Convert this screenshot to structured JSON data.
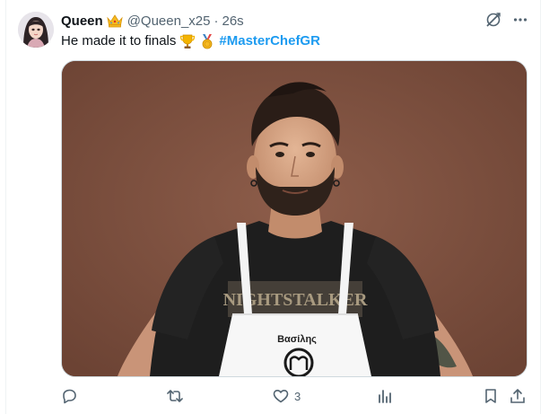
{
  "post": {
    "author": {
      "display_name": "Queen",
      "badge_icon": "crown-emoji",
      "handle": "@Queen_x25",
      "separator": "·",
      "time": "26s"
    },
    "text": {
      "body": "He made it to finals",
      "emojis": [
        "trophy-emoji",
        "medal-emoji"
      ],
      "hashtag": "#MasterChefGR"
    },
    "media": {
      "apron_name": "Βασίλης",
      "shirt_print": "NIGHTSTALKER"
    },
    "actions": {
      "reply": {
        "icon": "reply-icon"
      },
      "repost": {
        "icon": "repost-icon"
      },
      "like": {
        "icon": "heart-icon",
        "count": "3"
      },
      "views": {
        "icon": "views-icon"
      },
      "bookmark": {
        "icon": "bookmark-icon"
      },
      "share": {
        "icon": "share-icon"
      }
    },
    "top_actions": {
      "grok": {
        "icon": "grok-icon"
      },
      "more": {
        "icon": "more-icon"
      }
    }
  },
  "colors": {
    "accent": "#1d9bf0",
    "muted": "#536471",
    "text": "#0f1419",
    "photo_background": "#7a5040"
  }
}
